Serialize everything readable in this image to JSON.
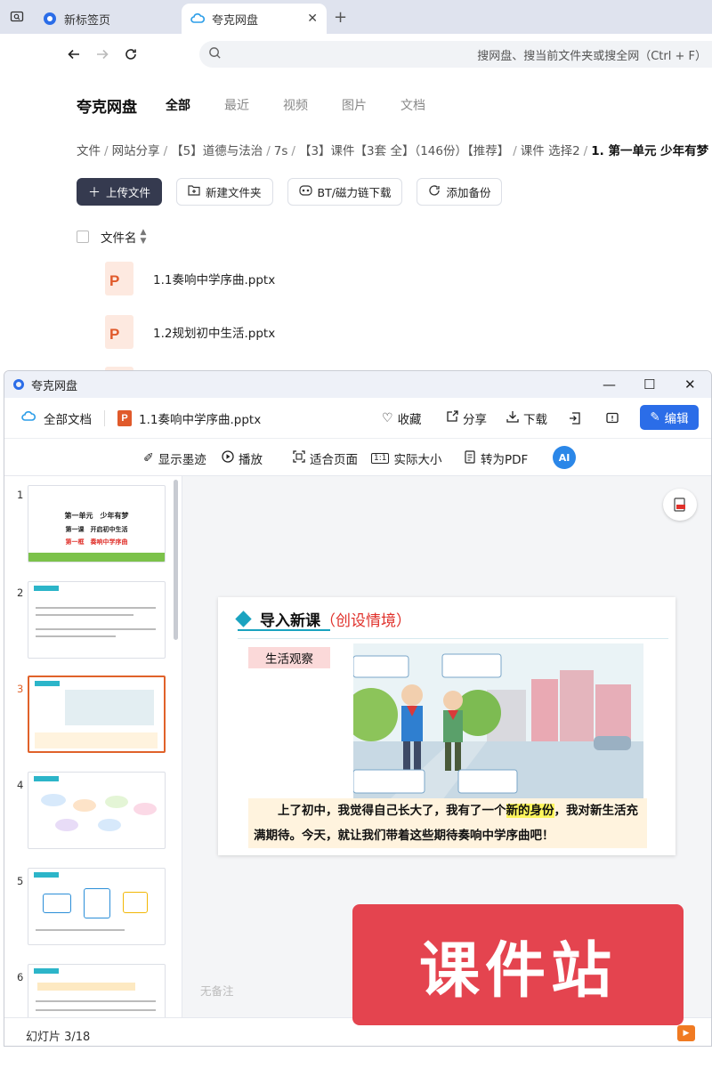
{
  "browser": {
    "tabs": [
      {
        "label": "新标签页",
        "icon": "browser-logo-icon",
        "active": false
      },
      {
        "label": "夸克网盘",
        "icon": "cloud-drive-icon",
        "active": true
      }
    ],
    "address_placeholder": "搜网盘、搜当前文件夹或搜全网（Ctrl + F）"
  },
  "drive": {
    "brand": "夸克网盘",
    "tabs": [
      "全部",
      "最近",
      "视频",
      "图片",
      "文档"
    ],
    "breadcrumb": [
      "文件",
      "网站分享",
      "【5】道德与法治",
      "7s",
      "【3】课件【3套 全】（146份）【推荐】",
      "课件 选择2",
      "1. 第一单元 少年有梦"
    ],
    "actions": {
      "upload": "上传文件",
      "new_folder": "新建文件夹",
      "bt": "BT/磁力链下载",
      "backup": "添加备份"
    },
    "file_header": "文件名",
    "files": [
      "1.1奏响中学序曲.pptx",
      "1.2规划初中生活.pptx"
    ]
  },
  "viewer": {
    "window_title": "夸克网盘",
    "all_docs": "全部文档",
    "file_name": "1.1奏响中学序曲.pptx",
    "favorite": "收藏",
    "share": "分享",
    "download": "下载",
    "edit": "编辑",
    "tools": {
      "ink": "显示墨迹",
      "play": "播放",
      "fit": "适合页面",
      "actual": "实际大小",
      "pdf": "转为PDF",
      "ai": "AI"
    },
    "thumbnails": {
      "numbers": [
        "1",
        "2",
        "3",
        "4",
        "5",
        "6"
      ],
      "t1_line1": "第一单元　少年有梦",
      "t1_line2": "第一课　开启初中生活",
      "t1_line3": "第一框　奏响中学序曲"
    },
    "slide": {
      "title": "导入新课",
      "title_suffix": "（创设情境）",
      "label": "生活观察",
      "text_before": "上了初中，我觉得自己长大了，我有了一个",
      "text_highlight": "新的身份",
      "text_after": "，我对新生活充满期待。今天，就让我们带着这些期待奏响中学序曲吧！"
    },
    "notes_placeholder": "无备注",
    "status": "幻灯片 3/18",
    "watermark": "课件站"
  }
}
